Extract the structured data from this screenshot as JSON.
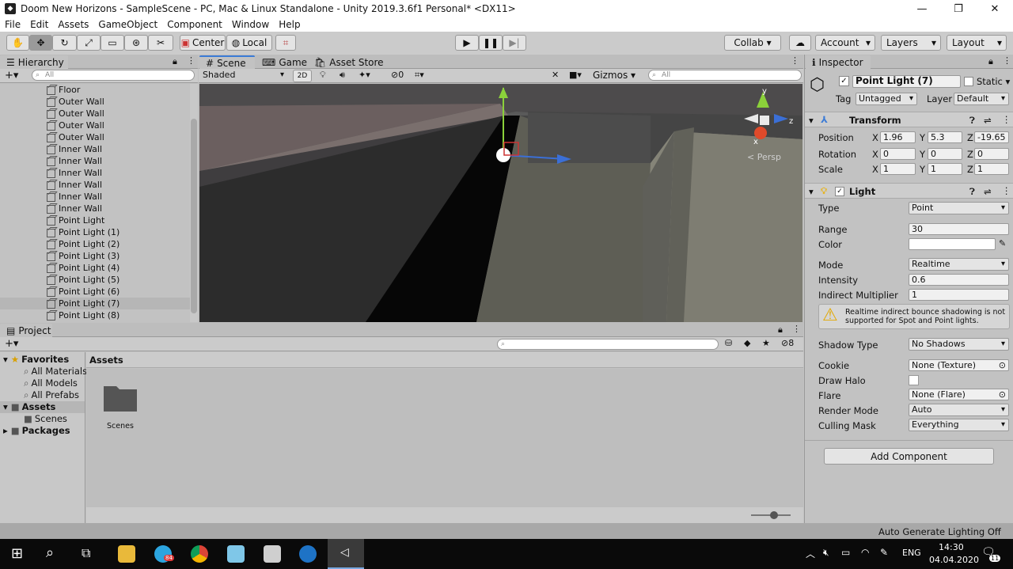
{
  "window": {
    "title": "Doom New Horizons - SampleScene - PC, Mac & Linux Standalone - Unity 2019.3.6f1 Personal* <DX11>",
    "minimize": "—",
    "maximize": "❐",
    "close": "✕"
  },
  "menu": [
    "File",
    "Edit",
    "Assets",
    "GameObject",
    "Component",
    "Window",
    "Help"
  ],
  "toolbar": {
    "pivot": "Center",
    "space": "Local",
    "collab": "Collab ▾",
    "account": "Account",
    "layers": "Layers",
    "layout": "Layout"
  },
  "hierarchy": {
    "tab": "Hierarchy",
    "search_placeholder": "All",
    "items": [
      {
        "label": "Floor"
      },
      {
        "label": "Outer Wall"
      },
      {
        "label": "Outer Wall"
      },
      {
        "label": "Outer Wall"
      },
      {
        "label": "Outer Wall"
      },
      {
        "label": "Inner Wall"
      },
      {
        "label": "Inner Wall"
      },
      {
        "label": "Inner Wall"
      },
      {
        "label": "Inner Wall"
      },
      {
        "label": "Inner Wall"
      },
      {
        "label": "Inner Wall"
      },
      {
        "label": "Point Light"
      },
      {
        "label": "Point Light (1)"
      },
      {
        "label": "Point Light (2)"
      },
      {
        "label": "Point Light (3)"
      },
      {
        "label": "Point Light (4)"
      },
      {
        "label": "Point Light (5)"
      },
      {
        "label": "Point Light (6)"
      },
      {
        "label": "Point Light (7)",
        "selected": true
      },
      {
        "label": "Point Light (8)"
      }
    ]
  },
  "scene": {
    "tabs": [
      "Scene",
      "Game",
      "Asset Store"
    ],
    "shading": "Shaded",
    "mode2d": "2D",
    "hidden_count": "0",
    "gizmos": "Gizmos",
    "search_placeholder": "All",
    "persp_label": "< Persp",
    "axis_y": "y",
    "axis_z": "z",
    "axis_x": "x"
  },
  "inspector": {
    "tab": "Inspector",
    "object_name": "Point Light (7)",
    "static_label": "Static",
    "tag_label": "Tag",
    "tag_value": "Untagged",
    "layer_label": "Layer",
    "layer_value": "Default",
    "transform": {
      "title": "Transform",
      "position_label": "Position",
      "rotation_label": "Rotation",
      "scale_label": "Scale",
      "position": {
        "x": "1.96",
        "y": "5.3",
        "z": "-19.65"
      },
      "rotation": {
        "x": "0",
        "y": "0",
        "z": "0"
      },
      "scale": {
        "x": "1",
        "y": "1",
        "z": "1"
      },
      "x": "X",
      "y": "Y",
      "z": "Z"
    },
    "light": {
      "title": "Light",
      "rows": [
        {
          "label": "Type",
          "value": "Point",
          "kind": "dropdown"
        },
        {
          "label": "Range",
          "value": "30",
          "kind": "field"
        },
        {
          "label": "Color",
          "value": "",
          "kind": "color"
        },
        {
          "label": "Mode",
          "value": "Realtime",
          "kind": "dropdown"
        },
        {
          "label": "Intensity",
          "value": "0.6",
          "kind": "field"
        },
        {
          "label": "Indirect Multiplier",
          "value": "1",
          "kind": "field"
        }
      ],
      "warning": "Realtime indirect bounce shadowing is not supported for Spot and Point lights.",
      "rows2": [
        {
          "label": "Shadow Type",
          "value": "No Shadows",
          "kind": "dropdown"
        },
        {
          "label": "Cookie",
          "value": "None (Texture)",
          "kind": "object"
        },
        {
          "label": "Draw Halo",
          "value": "",
          "kind": "checkbox"
        },
        {
          "label": "Flare",
          "value": "None (Flare)",
          "kind": "object"
        },
        {
          "label": "Render Mode",
          "value": "Auto",
          "kind": "dropdown"
        },
        {
          "label": "Culling Mask",
          "value": "Everything",
          "kind": "dropdown"
        }
      ]
    },
    "add_component": "Add Component"
  },
  "project": {
    "tab": "Project",
    "hidden_count": "8",
    "tree": [
      {
        "label": "Favorites",
        "bold": true,
        "indent": 0,
        "icon": "star"
      },
      {
        "label": "All Materials",
        "indent": 1,
        "icon": "search"
      },
      {
        "label": "All Models",
        "indent": 1,
        "icon": "search"
      },
      {
        "label": "All Prefabs",
        "indent": 1,
        "icon": "search"
      },
      {
        "label": "Assets",
        "bold": true,
        "indent": 0,
        "icon": "folder"
      },
      {
        "label": "Scenes",
        "indent": 1,
        "icon": "folder"
      },
      {
        "label": "Packages",
        "bold": true,
        "indent": 0,
        "icon": "folder"
      }
    ],
    "breadcrumb": "Assets",
    "assets": [
      {
        "label": "Scenes"
      }
    ]
  },
  "status": {
    "text": "Auto Generate Lighting Off"
  },
  "taskbar": {
    "lang": "ENG",
    "time": "14:30",
    "date": "04.04.2020",
    "notif_count": "11",
    "telegram_badge": "84"
  },
  "colors": {
    "unity_blue": "#3b7bd6",
    "panel_bg": "#c2c2c2",
    "selected_row": "#b6b6b6"
  }
}
